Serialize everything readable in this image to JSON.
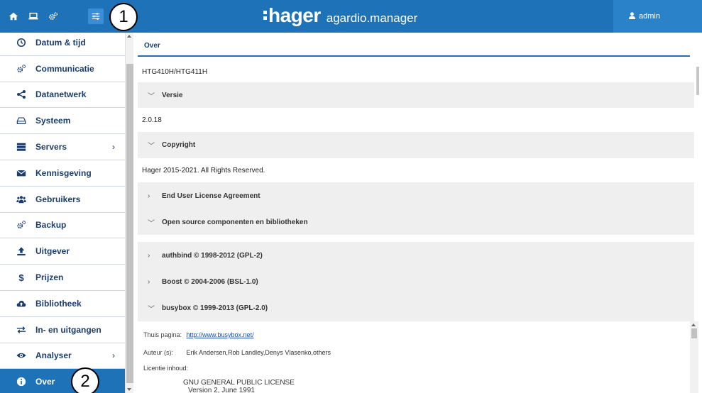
{
  "topbar": {
    "brand": "hager",
    "product": "agardio.manager",
    "user": "admin",
    "icons": [
      "home-icon",
      "monitor-icon",
      "cogs-icon",
      "sliders-icon"
    ]
  },
  "callouts": {
    "one": "1",
    "two": "2"
  },
  "sidebar": {
    "items": [
      {
        "label": "Datum & tijd",
        "icon": "clock-icon"
      },
      {
        "label": "Communicatie",
        "icon": "cogs-icon"
      },
      {
        "label": "Datanetwerk",
        "icon": "share-icon"
      },
      {
        "label": "Systeem",
        "icon": "drive-icon"
      },
      {
        "label": "Servers",
        "icon": "server-icon",
        "chevron": "›"
      },
      {
        "label": "Kennisgeving",
        "icon": "envelope-icon"
      },
      {
        "label": "Gebruikers",
        "icon": "users-icon"
      },
      {
        "label": "Backup",
        "icon": "cogs-icon"
      },
      {
        "label": "Uitgever",
        "icon": "upload-icon"
      },
      {
        "label": "Prijzen",
        "icon": "dollar-icon"
      },
      {
        "label": "Bibliotheek",
        "icon": "cloud-upload-icon"
      },
      {
        "label": "In- en uitgangen",
        "icon": "exchange-icon"
      },
      {
        "label": "Analyser",
        "icon": "eye-icon",
        "chevron": "›"
      },
      {
        "label": "Over",
        "icon": "info-icon",
        "active": true
      }
    ]
  },
  "main": {
    "tab": "Over",
    "model": "HTG410H/HTG411H",
    "version_header": "Versie",
    "version": "2.0.18",
    "copyright_header": "Copyright",
    "copyright": "Hager 2015-2021. All Rights Reserved.",
    "eula_header": "End User License Agreement",
    "oss_header": "Open source componenten en bibliotheken",
    "components": [
      {
        "label": "authbind © 1998-2012 (GPL-2)",
        "arrow": "›"
      },
      {
        "label": "Boost © 2004-2006 (BSL-1.0)",
        "arrow": "›"
      },
      {
        "label": "busybox © 1999-2013 (GPL-2.0)",
        "arrow": "⌄"
      }
    ],
    "busybox": {
      "home_label": "Thuis pagina:",
      "home_url": "http://www.busybox.net/",
      "authors_label": "Auteur (s):",
      "authors": "Erik Andersen,Rob Landley,Denys Vlasenko,others",
      "license_label": "Licentie inhoud:",
      "license_line1": "GNU GENERAL PUBLIC LICENSE",
      "license_line2": "Version 2, June 1991"
    }
  },
  "colors": {
    "primary": "#1e73b8",
    "nav_text": "#1a3d6e",
    "section_bg": "#efefef"
  }
}
